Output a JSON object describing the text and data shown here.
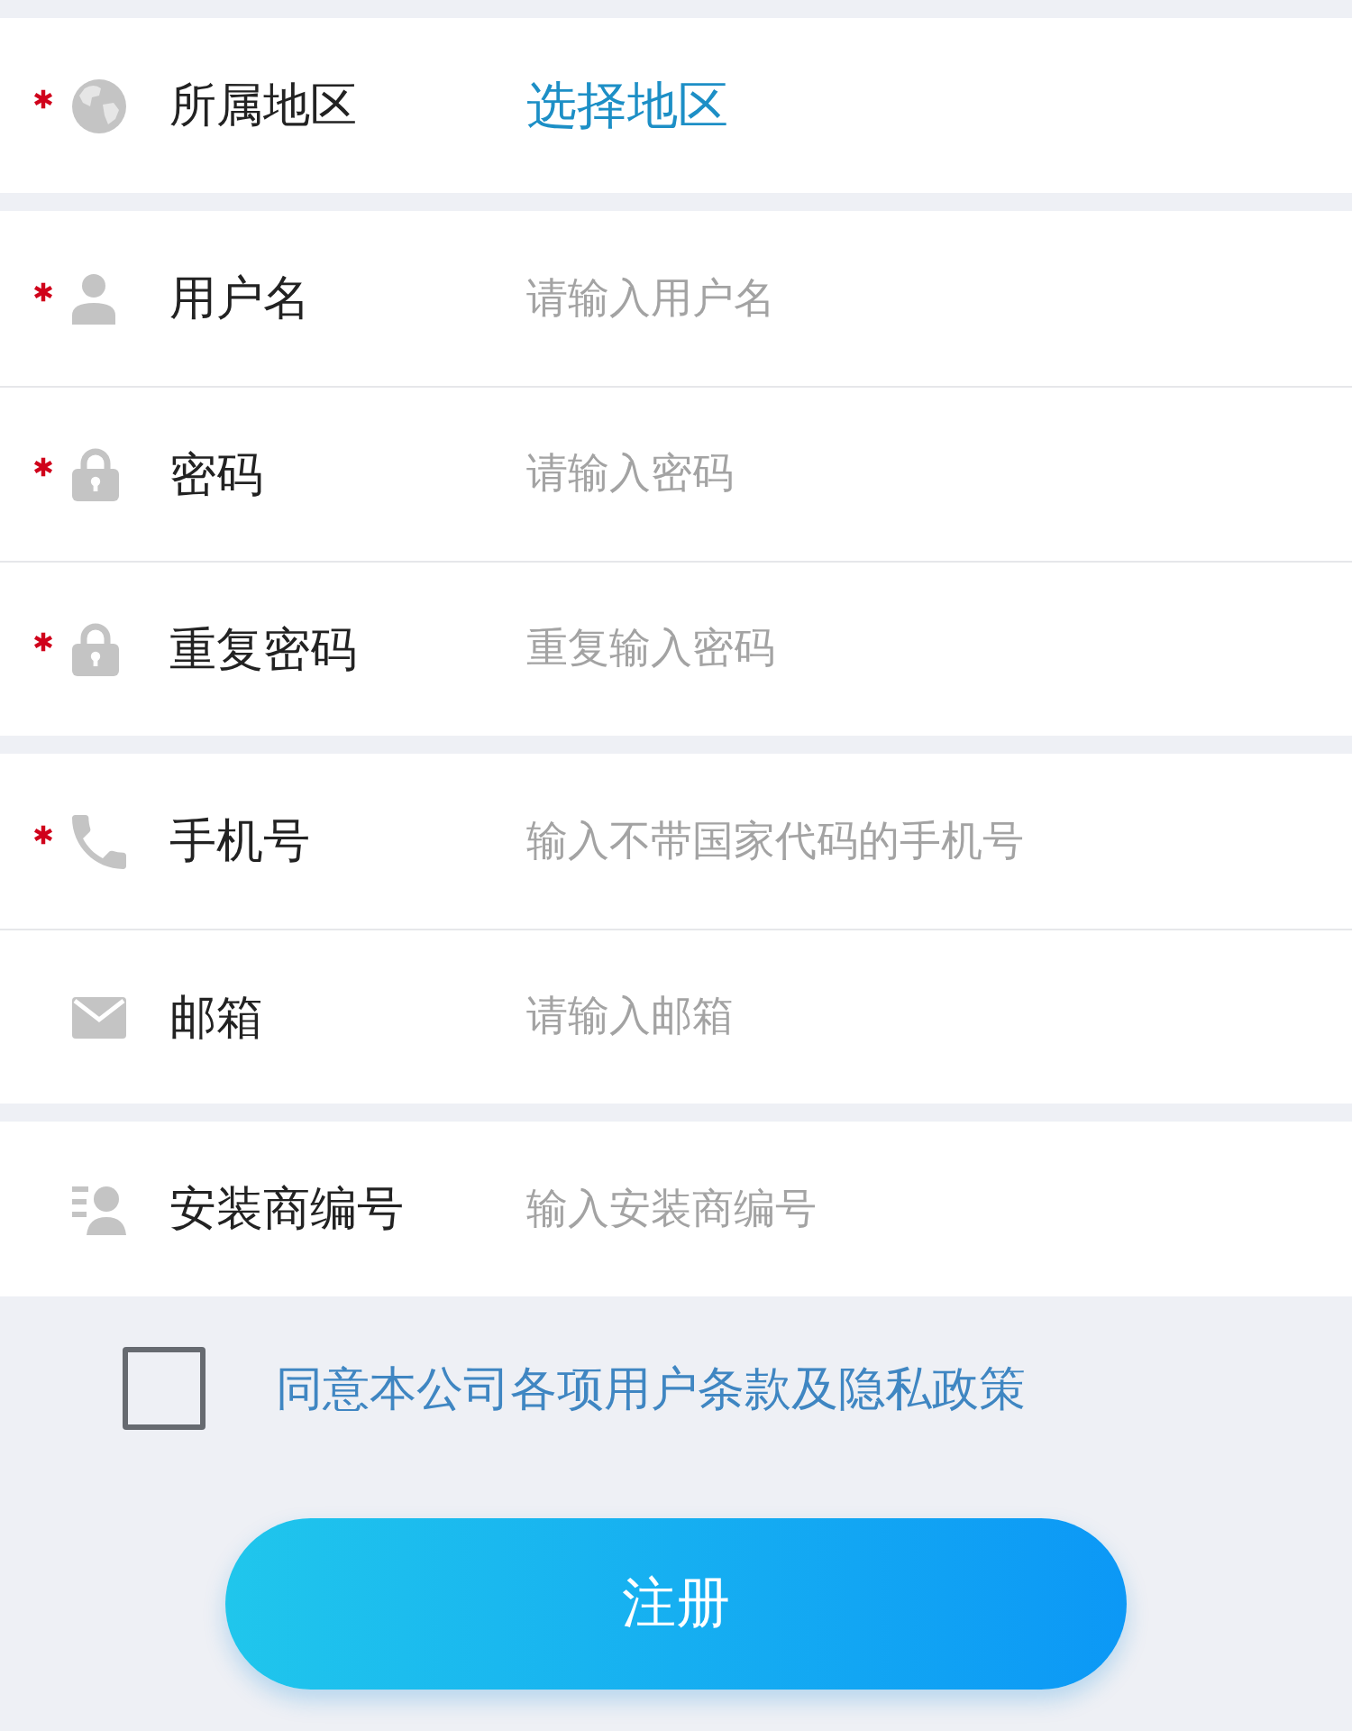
{
  "sections": [
    {
      "fields": [
        {
          "kind": "region",
          "required": true,
          "label": "所属地区",
          "value": "选择地区"
        }
      ]
    },
    {
      "fields": [
        {
          "kind": "user",
          "required": true,
          "label": "用户名",
          "placeholder": "请输入用户名"
        },
        {
          "kind": "password",
          "required": true,
          "label": "密码",
          "placeholder": "请输入密码"
        },
        {
          "kind": "password",
          "required": true,
          "label": "重复密码",
          "placeholder": "重复输入密码"
        }
      ]
    },
    {
      "fields": [
        {
          "kind": "phone",
          "required": true,
          "label": "手机号",
          "placeholder": "输入不带国家代码的手机号"
        },
        {
          "kind": "email",
          "required": false,
          "label": "邮箱",
          "placeholder": "请输入邮箱"
        }
      ]
    },
    {
      "fields": [
        {
          "kind": "installer",
          "required": false,
          "label": "安装商编号",
          "placeholder": "输入安装商编号"
        }
      ]
    }
  ],
  "agreement": {
    "checked": false,
    "label": "同意本公司各项用户条款及隐私政策"
  },
  "submit_button": {
    "label": "注册"
  }
}
